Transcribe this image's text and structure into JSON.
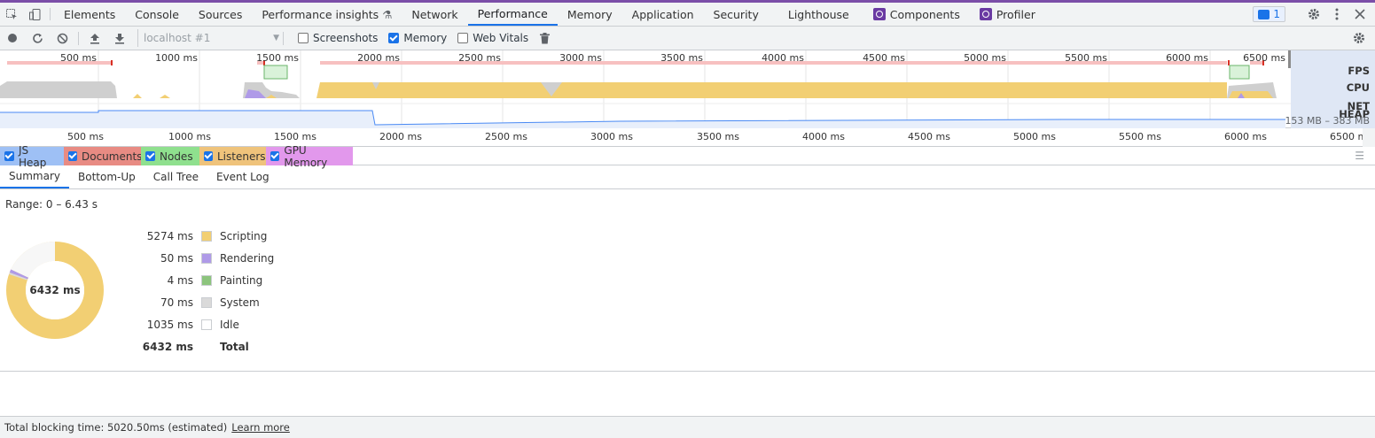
{
  "tabbar": {
    "tabs": [
      {
        "label": "Elements"
      },
      {
        "label": "Console"
      },
      {
        "label": "Sources"
      },
      {
        "label": "Performance insights"
      },
      {
        "label": "Network"
      },
      {
        "label": "Performance",
        "active": true
      },
      {
        "label": "Memory"
      },
      {
        "label": "Application"
      },
      {
        "label": "Security"
      },
      {
        "label": "Lighthouse"
      },
      {
        "label": "Components"
      },
      {
        "label": "Profiler"
      }
    ],
    "issues_count": "1"
  },
  "toolbar": {
    "target": "localhost #1",
    "screenshots": "Screenshots",
    "memory": "Memory",
    "web_vitals": "Web Vitals"
  },
  "overview": {
    "tracks": [
      "FPS",
      "CPU",
      "NET",
      "HEAP"
    ],
    "heap_range": "153 MB – 383 MB"
  },
  "ruler": {
    "ticks": [
      "500 ms",
      "1000 ms",
      "1500 ms",
      "2000 ms",
      "2500 ms",
      "3000 ms",
      "3500 ms",
      "4000 ms",
      "4500 ms",
      "5000 ms",
      "5500 ms",
      "6000 ms",
      "6500 ms"
    ]
  },
  "counters": [
    {
      "label": "JS Heap",
      "color": "#4a8af4"
    },
    {
      "label": "Documents",
      "color": "#d9534f"
    },
    {
      "label": "Nodes",
      "color": "#5fd068"
    },
    {
      "label": "Listeners",
      "color": "#e8b23a"
    },
    {
      "label": "GPU Memory",
      "color": "#d070e0"
    }
  ],
  "details_tabs": [
    "Summary",
    "Bottom-Up",
    "Call Tree",
    "Event Log"
  ],
  "summary": {
    "range": "Range: 0 – 6.43 s",
    "total_center": "6432 ms",
    "rows": [
      {
        "value": "5274 ms",
        "label": "Scripting",
        "color": "#f2cf73"
      },
      {
        "value": "50 ms",
        "label": "Rendering",
        "color": "#af9ae8"
      },
      {
        "value": "4 ms",
        "label": "Painting",
        "color": "#8cc47d"
      },
      {
        "value": "70 ms",
        "label": "System",
        "color": "#dadada"
      },
      {
        "value": "1035 ms",
        "label": "Idle",
        "color": "#ffffff"
      }
    ],
    "total_value": "6432 ms",
    "total_label": "Total"
  },
  "footer": {
    "text": "Total blocking time: 5020.50ms (estimated)",
    "link": "Learn more"
  }
}
